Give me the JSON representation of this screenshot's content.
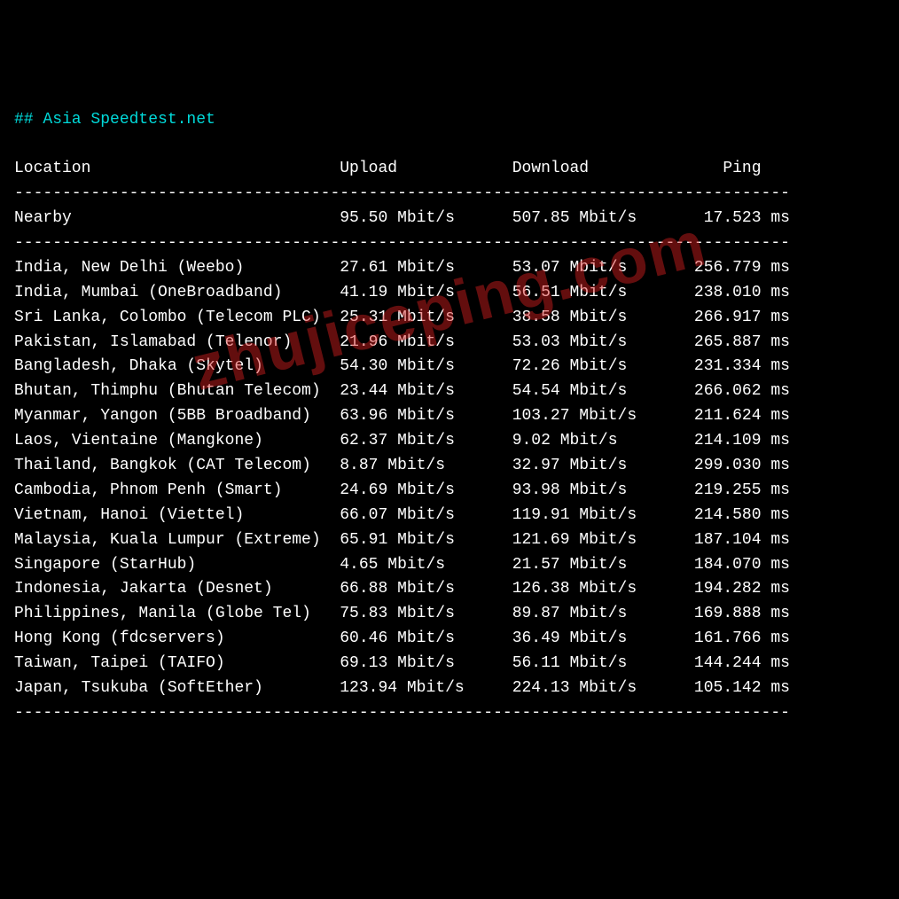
{
  "title": "## Asia Speedtest.net",
  "headers": {
    "location": "Location",
    "upload": "Upload",
    "download": "Download",
    "ping": "Ping"
  },
  "divider": "---------------------------------------------------------------------------------",
  "nearby": {
    "location": "Nearby",
    "upload": "95.50 Mbit/s",
    "download": "507.85 Mbit/s",
    "ping": "17.523 ms"
  },
  "rows": [
    {
      "location": "India, New Delhi (Weebo)",
      "upload": "27.61 Mbit/s",
      "download": "53.07 Mbit/s",
      "ping": "256.779 ms"
    },
    {
      "location": "India, Mumbai (OneBroadband)",
      "upload": "41.19 Mbit/s",
      "download": "56.51 Mbit/s",
      "ping": "238.010 ms"
    },
    {
      "location": "Sri Lanka, Colombo (Telecom PLC)",
      "upload": "25.31 Mbit/s",
      "download": "38.58 Mbit/s",
      "ping": "266.917 ms"
    },
    {
      "location": "Pakistan, Islamabad (Telenor)",
      "upload": "21.96 Mbit/s",
      "download": "53.03 Mbit/s",
      "ping": "265.887 ms"
    },
    {
      "location": "Bangladesh, Dhaka (Skytel)",
      "upload": "54.30 Mbit/s",
      "download": "72.26 Mbit/s",
      "ping": "231.334 ms"
    },
    {
      "location": "Bhutan, Thimphu (Bhutan Telecom)",
      "upload": "23.44 Mbit/s",
      "download": "54.54 Mbit/s",
      "ping": "266.062 ms"
    },
    {
      "location": "Myanmar, Yangon (5BB Broadband)",
      "upload": "63.96 Mbit/s",
      "download": "103.27 Mbit/s",
      "ping": "211.624 ms"
    },
    {
      "location": "Laos, Vientaine (Mangkone)",
      "upload": "62.37 Mbit/s",
      "download": "9.02 Mbit/s",
      "ping": "214.109 ms"
    },
    {
      "location": "Thailand, Bangkok (CAT Telecom)",
      "upload": "8.87 Mbit/s",
      "download": "32.97 Mbit/s",
      "ping": "299.030 ms"
    },
    {
      "location": "Cambodia, Phnom Penh (Smart)",
      "upload": "24.69 Mbit/s",
      "download": "93.98 Mbit/s",
      "ping": "219.255 ms"
    },
    {
      "location": "Vietnam, Hanoi (Viettel)",
      "upload": "66.07 Mbit/s",
      "download": "119.91 Mbit/s",
      "ping": "214.580 ms"
    },
    {
      "location": "Malaysia, Kuala Lumpur (Extreme)",
      "upload": "65.91 Mbit/s",
      "download": "121.69 Mbit/s",
      "ping": "187.104 ms"
    },
    {
      "location": "Singapore (StarHub)",
      "upload": "4.65 Mbit/s",
      "download": "21.57 Mbit/s",
      "ping": "184.070 ms"
    },
    {
      "location": "Indonesia, Jakarta (Desnet)",
      "upload": "66.88 Mbit/s",
      "download": "126.38 Mbit/s",
      "ping": "194.282 ms"
    },
    {
      "location": "Philippines, Manila (Globe Tel)",
      "upload": "75.83 Mbit/s",
      "download": "89.87 Mbit/s",
      "ping": "169.888 ms"
    },
    {
      "location": "Hong Kong (fdcservers)",
      "upload": "60.46 Mbit/s",
      "download": "36.49 Mbit/s",
      "ping": "161.766 ms"
    },
    {
      "location": "Taiwan, Taipei (TAIFO)",
      "upload": "69.13 Mbit/s",
      "download": "56.11 Mbit/s",
      "ping": "144.244 ms"
    },
    {
      "location": "Japan, Tsukuba (SoftEther)",
      "upload": "123.94 Mbit/s",
      "download": "224.13 Mbit/s",
      "ping": "105.142 ms"
    }
  ],
  "watermark": "zhujiceping.com",
  "chart_data": {
    "type": "table",
    "title": "Asia Speedtest.net",
    "columns": [
      "Location",
      "Upload (Mbit/s)",
      "Download (Mbit/s)",
      "Ping (ms)"
    ],
    "rows": [
      [
        "Nearby",
        95.5,
        507.85,
        17.523
      ],
      [
        "India, New Delhi (Weebo)",
        27.61,
        53.07,
        256.779
      ],
      [
        "India, Mumbai (OneBroadband)",
        41.19,
        56.51,
        238.01
      ],
      [
        "Sri Lanka, Colombo (Telecom PLC)",
        25.31,
        38.58,
        266.917
      ],
      [
        "Pakistan, Islamabad (Telenor)",
        21.96,
        53.03,
        265.887
      ],
      [
        "Bangladesh, Dhaka (Skytel)",
        54.3,
        72.26,
        231.334
      ],
      [
        "Bhutan, Thimphu (Bhutan Telecom)",
        23.44,
        54.54,
        266.062
      ],
      [
        "Myanmar, Yangon (5BB Broadband)",
        63.96,
        103.27,
        211.624
      ],
      [
        "Laos, Vientaine (Mangkone)",
        62.37,
        9.02,
        214.109
      ],
      [
        "Thailand, Bangkok (CAT Telecom)",
        8.87,
        32.97,
        299.03
      ],
      [
        "Cambodia, Phnom Penh (Smart)",
        24.69,
        93.98,
        219.255
      ],
      [
        "Vietnam, Hanoi (Viettel)",
        66.07,
        119.91,
        214.58
      ],
      [
        "Malaysia, Kuala Lumpur (Extreme)",
        65.91,
        121.69,
        187.104
      ],
      [
        "Singapore (StarHub)",
        4.65,
        21.57,
        184.07
      ],
      [
        "Indonesia, Jakarta (Desnet)",
        66.88,
        126.38,
        194.282
      ],
      [
        "Philippines, Manila (Globe Tel)",
        75.83,
        89.87,
        169.888
      ],
      [
        "Hong Kong (fdcservers)",
        60.46,
        36.49,
        161.766
      ],
      [
        "Taiwan, Taipei (TAIFO)",
        69.13,
        56.11,
        144.244
      ],
      [
        "Japan, Tsukuba (SoftEther)",
        123.94,
        224.13,
        105.142
      ]
    ]
  }
}
